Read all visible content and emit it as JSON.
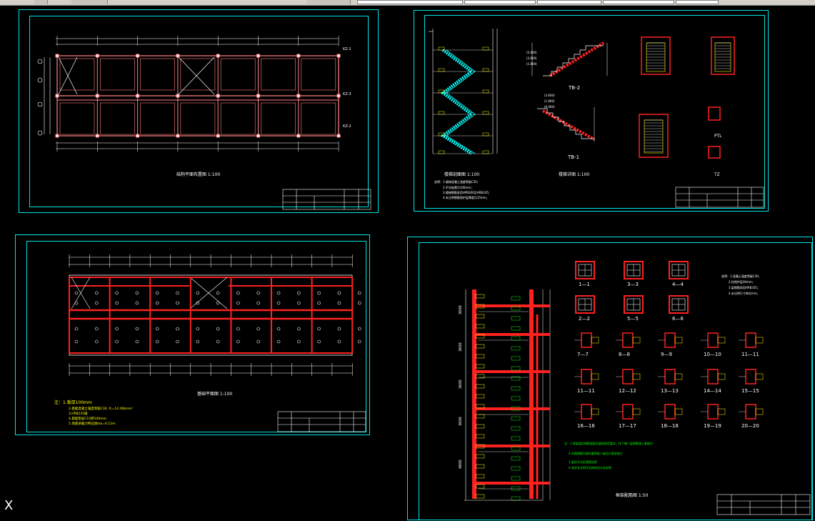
{
  "toolbar": {
    "layer_box": "",
    "combo_1": "",
    "combo_2": "",
    "combo_3": "",
    "combo_4": ""
  },
  "sheets": {
    "top_left": {
      "title": "结构平面布置图 1:100",
      "beams": [
        "KL-1",
        "KL-2",
        "KL-3",
        "KL-4",
        "KL-5",
        "KL-6",
        "KL-7",
        "KL-8",
        "L-1",
        "L-2",
        "XB-1",
        "XB-2",
        "XB-3"
      ],
      "side_labels": [
        "KZ-1",
        "KZ-2",
        "KZ-3"
      ]
    },
    "top_right": {
      "title_left": "楼梯剖面图 1:100",
      "title_center": "楼梯详图 1:100",
      "stair_1": "TB-1",
      "stair_2": "TB-2",
      "label_tz": "TZ",
      "label_ptl": "PTL",
      "notes": [
        "说明：1.楼梯混凝土强度等级C30；",
        "2.平台板厚为100mm；",
        "3.楼梯钢筋采用HPB300及HRB335；",
        "4.未注明钢筋保护层厚度为15mm。"
      ],
      "elev_1": [
        "(3.600)",
        "(1.800)",
        "(0.000)"
      ],
      "elev_2": [
        "(5.400)",
        "(3.600)",
        "(1.800)"
      ]
    },
    "bottom_left": {
      "title": "基础平面图 1:100",
      "notes": [
        "注：1.板厚100mm",
        "2.基础混凝土强度等级C30, fc=14.3N/mm²",
        "3.HPB235级",
        "4.基础垫层C15厚100mm",
        "5.地基承载力特征值fak=0.12m."
      ]
    },
    "bottom_right": {
      "title": "框架配筋图 1:50",
      "sections_top": [
        "1—1",
        "3—3",
        "4—4",
        "2—2",
        "5—5",
        "6—6"
      ],
      "sections_grid": [
        "7—7",
        "8—8",
        "9—9",
        "10—10",
        "11—11",
        "11—11",
        "12—12",
        "13—13",
        "14—14",
        "15—15",
        "16—16",
        "17—17",
        "18—18",
        "19—19",
        "20—20"
      ],
      "notes_right": [
        "说明：1.混凝土强度等级C30；",
        "2.柱保护层30mm；",
        "3.梁钢筋采用HRB335；",
        "4.未注明尺寸单位mm。"
      ],
      "notes_green": [
        "注：1.框架梁柱钢筋锚固长度按规范要求，柱下端一层钢筋锚入基础内",
        "2.本图钢筋均按抗震等级三级设计要求施工",
        "3.梁柱节点区箍筋加密",
        "4.其余未注明详见结构设计总说明"
      ],
      "elevations": [
        "3600",
        "3600",
        "3600",
        "3600",
        "4800"
      ]
    }
  },
  "ucs_icon": "X",
  "colors": {
    "background": "#000000",
    "frame": "#00e5e5",
    "line": "#ffffff",
    "beam": "#ff2020",
    "stair": "#00ffff",
    "yellow": "#ffff00",
    "green": "#00ff00"
  }
}
